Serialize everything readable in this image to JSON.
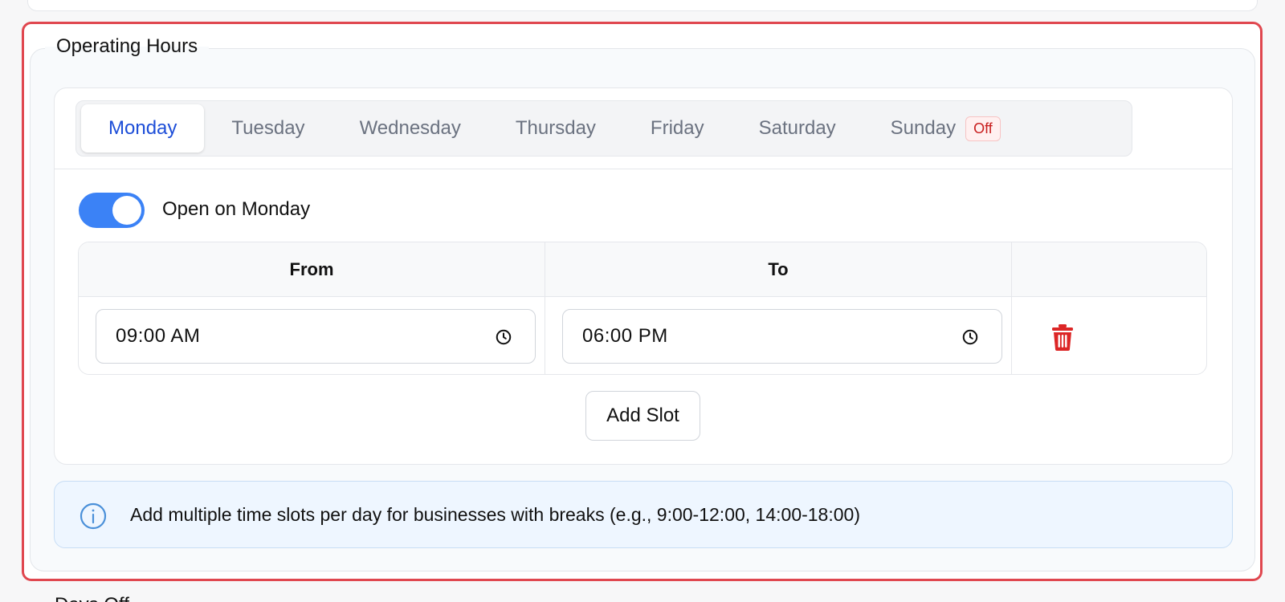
{
  "section": {
    "legend": "Operating Hours"
  },
  "tabs": [
    {
      "label": "Monday",
      "active": true
    },
    {
      "label": "Tuesday",
      "active": false
    },
    {
      "label": "Wednesday",
      "active": false
    },
    {
      "label": "Thursday",
      "active": false
    },
    {
      "label": "Friday",
      "active": false
    },
    {
      "label": "Saturday",
      "active": false
    },
    {
      "label": "Sunday",
      "active": false,
      "badge": "Off"
    }
  ],
  "day_panel": {
    "toggle_on": true,
    "toggle_label": "Open on Monday",
    "columns": {
      "from": "From",
      "to": "To"
    },
    "slots": [
      {
        "from": "09:00 AM",
        "to": "06:00 PM"
      }
    ],
    "add_slot_label": "Add Slot"
  },
  "info": {
    "text": "Add multiple time slots per day for businesses with breaks (e.g., 9:00-12:00, 14:00-18:00)"
  },
  "next_section": {
    "label": "Days Off"
  },
  "colors": {
    "accent": "#3b82f6",
    "active_tab_text": "#1d4ed8",
    "danger": "#dc2626",
    "highlight_border": "#e0474f"
  },
  "icons": {
    "time_field": "clock-icon",
    "delete_slot": "trash-icon",
    "info": "info-circle-icon"
  }
}
